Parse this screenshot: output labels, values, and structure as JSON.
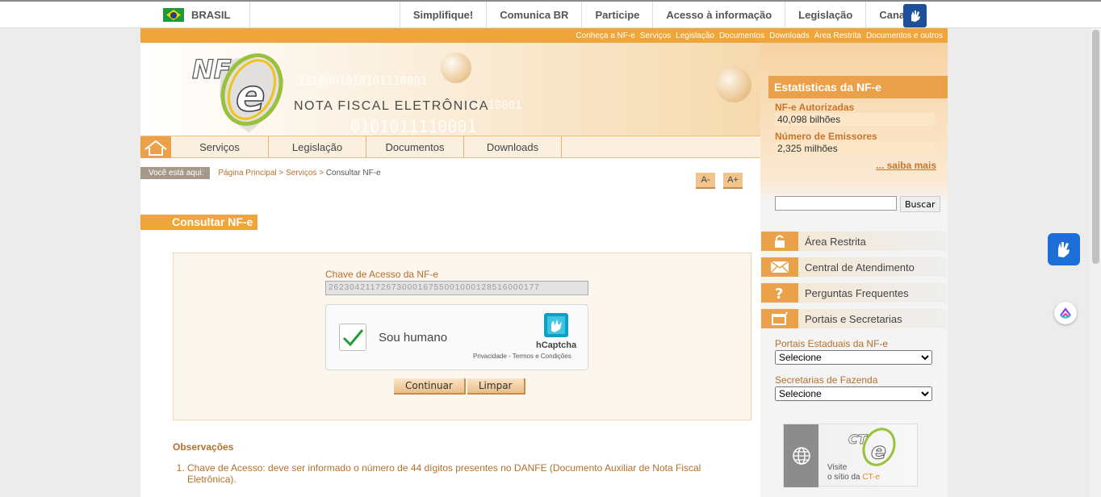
{
  "gov_bar": {
    "country": "BRASIL",
    "links": [
      "Simplifique!",
      "Comunica BR",
      "Participe",
      "Acesso à informação",
      "Legislação",
      "Canais"
    ]
  },
  "top_links": [
    "Conheça a NF-e",
    "Serviços",
    "Legislação",
    "Documentos",
    "Downloads",
    "Área Restrita",
    "Documentos e outros"
  ],
  "banner": {
    "logo_text": "NF",
    "logo_e": "e",
    "title": "NOTA FISCAL ELETRÔNICA",
    "binary_1": "1110001010101110001",
    "binary_2": "01110001",
    "binary_3": "0101011110001"
  },
  "main_nav": [
    "Serviços",
    "Legislação",
    "Documentos",
    "Downloads"
  ],
  "breadcrumb": {
    "label": "Você está aqui:",
    "home": "Página Principal",
    "sep1": " > ",
    "section": "Serviços",
    "sep2": " > ",
    "current": "Consultar NF-e"
  },
  "font_buttons": {
    "decrease": "A-",
    "increase": "A+"
  },
  "section_title": "Consultar NF-e",
  "form": {
    "key_label": "Chave de Acesso da NF-e",
    "key_value": "2623042117267300016755001000128516000177",
    "captcha_text": "Sou humano",
    "captcha_brand": "hCaptcha",
    "captcha_links": "Privacidade - Termos e Condições",
    "continue_label": "Continuar",
    "clear_label": "Limpar"
  },
  "observations": {
    "title": "Observações",
    "items": [
      "Chave de Acesso: deve ser informado o número de 44 dígitos presentes no DANFE (Documento Auxiliar de Nota Fiscal Eletrônica)."
    ]
  },
  "stats": {
    "title": "Estatísticas da NF-e",
    "authorized_label": "NF-e Autorizadas",
    "authorized_value": "40,098 bilhões",
    "issuers_label": "Número de Emissores",
    "issuers_value": "2,325 milhões",
    "more_link": "... saiba mais"
  },
  "search": {
    "button": "Buscar",
    "value": ""
  },
  "side_links": [
    "Área Restrita",
    "Central de Atendimento",
    "Perguntas Frequentes",
    "Portais e Secretarias"
  ],
  "portais": {
    "state_label": "Portais Estaduais da NF-e",
    "state_selected": "Selecione",
    "fazenda_label": "Secretarias de Fazenda",
    "fazenda_selected": "Selecione"
  },
  "cte": {
    "logo": "CT",
    "logo_e": "e",
    "line1": "Visite",
    "line2": "o sítio da ",
    "link": "CT-e"
  },
  "colors": {
    "accent": "#eba04a",
    "text_orange": "#b3702d",
    "gov_blue": "#1d4f9b"
  }
}
